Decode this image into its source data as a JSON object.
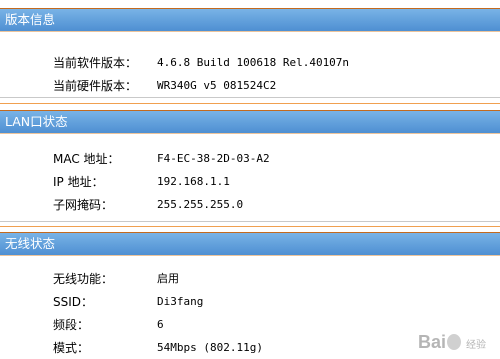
{
  "version": {
    "title": "版本信息",
    "rows": [
      {
        "label": "当前软件版本：",
        "value": "4.6.8 Build 100618 Rel.40107n"
      },
      {
        "label": "当前硬件版本：",
        "value": "WR340G v5 081524C2"
      }
    ]
  },
  "lan": {
    "title": "LAN口状态",
    "rows": [
      {
        "label": "MAC 地址：",
        "value": "F4-EC-38-2D-03-A2"
      },
      {
        "label": "IP 地址：",
        "value": "192.168.1.1"
      },
      {
        "label": "子网掩码：",
        "value": "255.255.255.0"
      }
    ]
  },
  "wireless": {
    "title": "无线状态",
    "rows": [
      {
        "label": "无线功能：",
        "value": "启用"
      },
      {
        "label": "SSID：",
        "value": "Di3fang"
      },
      {
        "label": "频段：",
        "value": "6"
      },
      {
        "label": "模式：",
        "value": "54Mbps (802.11g)"
      }
    ]
  },
  "watermark": {
    "text": "Bai",
    "suffix": "经验"
  },
  "colors": {
    "header_bg": "#5f9fdc",
    "divider": "#f0a050"
  }
}
